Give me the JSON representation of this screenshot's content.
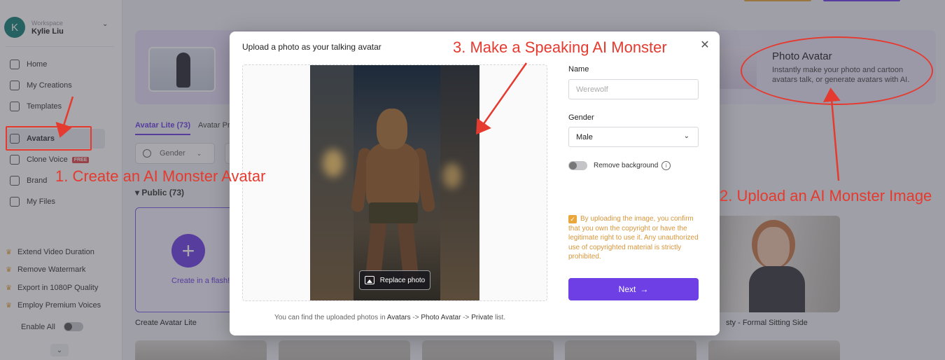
{
  "workspace": {
    "avatar_letter": "K",
    "label": "Workspace",
    "name": "Kylie Liu"
  },
  "sidebar": {
    "items": [
      {
        "label": "Home",
        "icon": "home-icon"
      },
      {
        "label": "My Creations",
        "icon": "play-icon"
      },
      {
        "label": "Templates",
        "icon": "templates-icon"
      },
      {
        "label": "Avatars",
        "icon": "avatar-icon",
        "active": true
      },
      {
        "label": "Clone Voice",
        "icon": "voice-icon",
        "badge": "FREE"
      },
      {
        "label": "Brand",
        "icon": "brand-icon"
      },
      {
        "label": "My Files",
        "icon": "upload-icon"
      }
    ],
    "upsells": [
      "Extend Video Duration",
      "Remove Watermark",
      "Export in 1080P Quality",
      "Employ Premium Voices"
    ],
    "enable_all": "Enable All"
  },
  "main": {
    "banner": {
      "title": "Photo Avatar",
      "desc": "Instantly make your photo and cartoon avatars talk, or generate avatars with AI."
    },
    "tabs": [
      "Avatar Lite (73)",
      "Avatar Pr"
    ],
    "gender_filter": "Gender",
    "public_label": "Public (73)",
    "create_card_link": "Create in a flash!",
    "create_card_label": "Create Avatar Lite",
    "woman_card_label": "sty - Formal Sitting Side"
  },
  "modal": {
    "title": "Upload a photo as your talking avatar",
    "replace_label": "Replace photo",
    "hint_prefix": "You can find the uploaded photos in ",
    "hint_avatars": "Avatars",
    "hint_sep1": " -> ",
    "hint_photo_avatar": "Photo Avatar",
    "hint_sep2": " -> ",
    "hint_private": "Private",
    "hint_suffix": " list.",
    "name_label": "Name",
    "name_placeholder": "Werewolf",
    "gender_label": "Gender",
    "gender_value": "Male",
    "remove_bg_label": "Remove background",
    "consent_text": "By uploading the image, you confirm that you own the copyright or have the legitimate right to use it. Any unauthorized use of copyrighted material is strictly prohibited.",
    "next_label": "Next",
    "accent_color": "#6d3fe5"
  },
  "annotations": {
    "step1": "1. Create an AI Monster Avatar",
    "step2": "2. Upload an AI Monster Image",
    "step3": "3. Make a Speaking AI Monster",
    "color": "#e53a2f"
  }
}
